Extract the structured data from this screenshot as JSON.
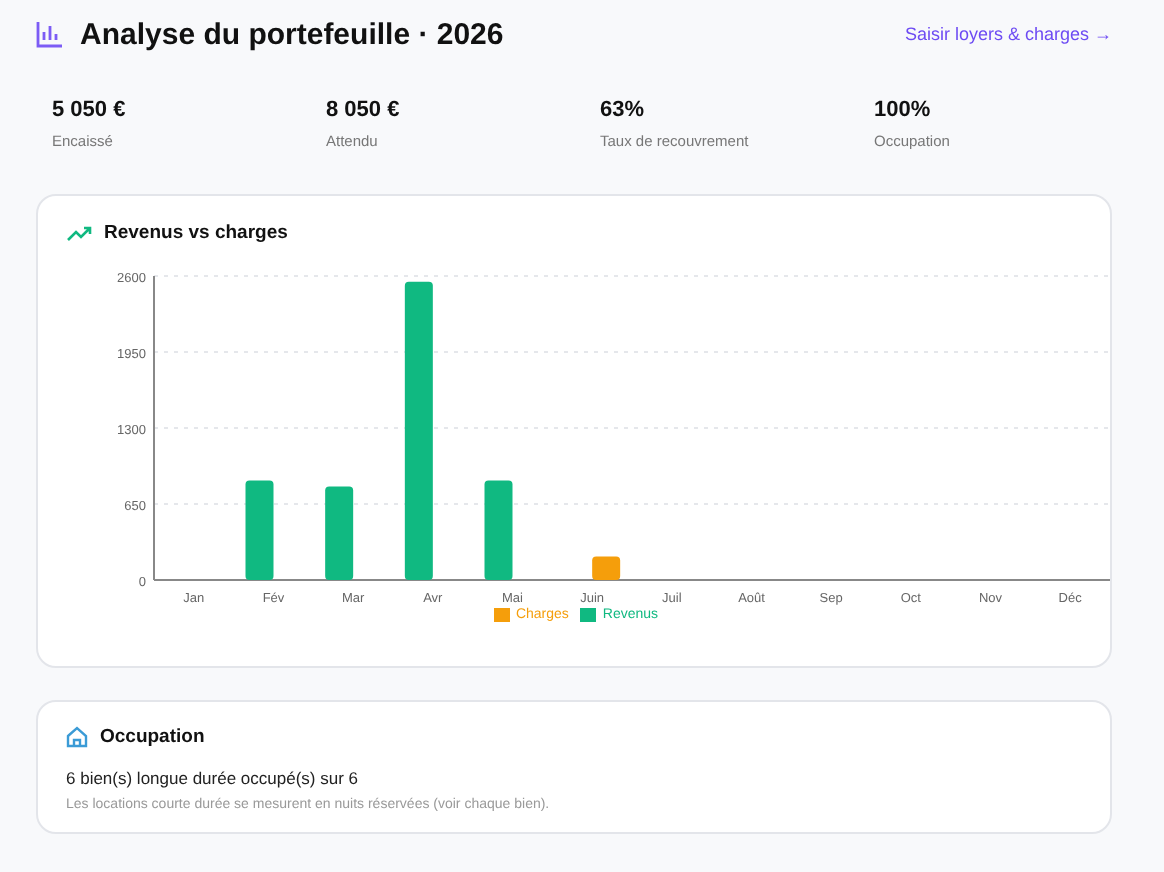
{
  "header": {
    "title": "Analyse du portefeuille · 2026",
    "link": "Saisir loyers & charges →"
  },
  "stats": [
    {
      "value": "5 050 €",
      "label": "Encaissé"
    },
    {
      "value": "8 050 €",
      "label": "Attendu"
    },
    {
      "value": "63%",
      "label": "Taux de recouvrement"
    },
    {
      "value": "100%",
      "label": "Occupation"
    }
  ],
  "chart_card": {
    "title": "Revenus vs charges",
    "chart_data": {
      "type": "bar",
      "categories": [
        "Jan",
        "Fév",
        "Mar",
        "Avr",
        "Mai",
        "Juin",
        "Juil",
        "Août",
        "Sep",
        "Oct",
        "Nov",
        "Déc"
      ],
      "series": [
        {
          "name": "Revenus",
          "color": "#10b981",
          "values": [
            0,
            850,
            800,
            2550,
            850,
            0,
            0,
            0,
            0,
            0,
            0,
            0
          ]
        },
        {
          "name": "Charges",
          "color": "#f59e0b",
          "values": [
            0,
            0,
            0,
            0,
            0,
            200,
            0,
            0,
            0,
            0,
            0,
            0
          ]
        }
      ],
      "ylim": [
        0,
        2600
      ],
      "yticks": [
        0,
        650,
        1300,
        1950,
        2600
      ],
      "grid": true
    }
  },
  "occupation": {
    "title": "Occupation",
    "summary": "6 bien(s) longue durée occupé(s) sur 6",
    "note": "Les locations courte durée se mesurent en nuits réservées (voir chaque bien)."
  }
}
